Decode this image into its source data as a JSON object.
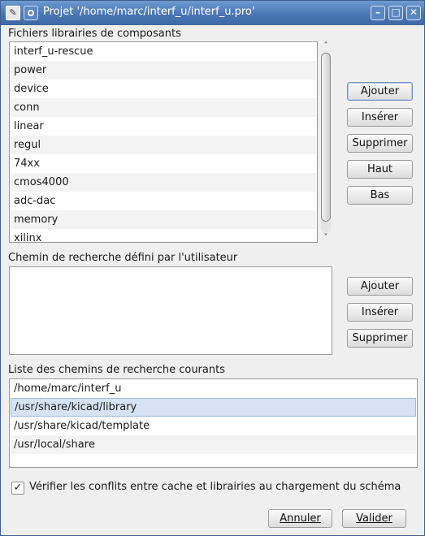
{
  "window": {
    "title": "Projet '/home/marc/interf_u/interf_u.pro'",
    "menu_icon": "window-menu-icon",
    "minimize_glyph": "–",
    "maximize_glyph": "□",
    "close_glyph": "✕"
  },
  "libraries": {
    "label": "Fichiers librairies de composants",
    "items": [
      "interf_u-rescue",
      "power",
      "device",
      "conn",
      "linear",
      "regul",
      "74xx",
      "cmos4000",
      "adc-dac",
      "memory",
      "xilinx"
    ],
    "scroll_up": "˄",
    "scroll_down": "˅",
    "buttons": {
      "add": "Ajouter",
      "insert": "Insérer",
      "remove": "Supprimer",
      "up": "Haut",
      "down": "Bas"
    }
  },
  "user_paths": {
    "label": "Chemin de recherche défini par l'utilisateur",
    "items": [],
    "buttons": {
      "add": "Ajouter",
      "insert": "Insérer",
      "remove": "Supprimer"
    }
  },
  "current_paths": {
    "label": "Liste des chemins de recherche courants",
    "items": [
      "/home/marc/interf_u",
      "/usr/share/kicad/library",
      "/usr/share/kicad/template",
      "/usr/local/share"
    ],
    "selected_index": 1
  },
  "options": {
    "check_conflicts_label": "Vérifier les conflits entre cache et librairies au chargement du schéma",
    "check_conflicts_checked": true,
    "check_glyph": "✓"
  },
  "footer": {
    "cancel_label": "Annuler",
    "ok_label": "Valider"
  }
}
